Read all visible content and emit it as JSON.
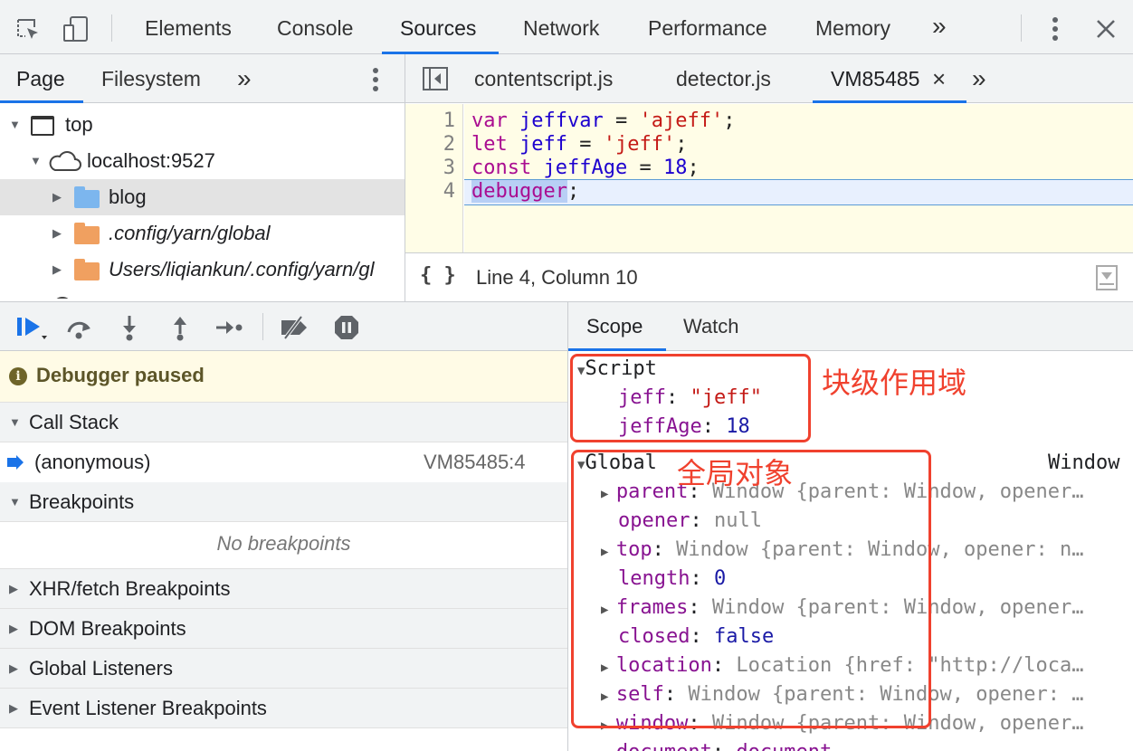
{
  "topbar": {
    "tabs": [
      "Elements",
      "Console",
      "Sources",
      "Network",
      "Performance",
      "Memory"
    ],
    "more": "»"
  },
  "navigator": {
    "tabs": [
      "Page",
      "Filesystem"
    ],
    "more": "»",
    "tree": [
      {
        "label": "top"
      },
      {
        "label": "localhost:9527"
      },
      {
        "label": "blog"
      },
      {
        "label": ".config/yarn/global"
      },
      {
        "label": "Users/liqiankun/.config/yarn/gl"
      }
    ]
  },
  "editor": {
    "tabs": [
      "contentscript.js",
      "detector.js",
      "VM85485"
    ],
    "more": "»",
    "close": "×",
    "line_numbers": [
      "1",
      "2",
      "3",
      "4"
    ],
    "code": [
      {
        "kw": "var",
        "name": " jeffvar",
        "op": " = ",
        "val": "'ajeff'",
        "end": ";"
      },
      {
        "kw": "let",
        "name": " jeff",
        "op": " = ",
        "val": "'jeff'",
        "end": ";"
      },
      {
        "kw": "const",
        "name": " jeffAge",
        "op": " = ",
        "val": "18",
        "end": ";"
      },
      {
        "kw": "debugger",
        "name": "",
        "op": "",
        "val": "",
        "end": ";"
      }
    ],
    "format_label": "{ }",
    "status": "Line 4, Column 10"
  },
  "debugger": {
    "paused": "Debugger paused",
    "sections": {
      "call_stack": "Call Stack",
      "breakpoints": "Breakpoints",
      "xhr": "XHR/fetch Breakpoints",
      "dom": "DOM Breakpoints",
      "global_listeners": "Global Listeners",
      "event_listener": "Event Listener Breakpoints"
    },
    "frame": {
      "name": "(anonymous)",
      "location": "VM85485:4"
    },
    "no_breakpoints": "No breakpoints"
  },
  "scope": {
    "tabs": [
      "Scope",
      "Watch"
    ],
    "script": {
      "title": "Script",
      "items": [
        {
          "key": "jeff",
          "value": "\"jeff\""
        },
        {
          "key": "jeffAge",
          "value": "18"
        }
      ]
    },
    "global": {
      "title": "Global",
      "type": "Window",
      "items": [
        {
          "key": "parent",
          "value": "Window {parent: Window, opener…"
        },
        {
          "key": "opener",
          "value": "null"
        },
        {
          "key": "top",
          "value": "Window {parent: Window, opener: n…"
        },
        {
          "key": "length",
          "value": "0"
        },
        {
          "key": "frames",
          "value": "Window {parent: Window, opener…"
        },
        {
          "key": "closed",
          "value": "false"
        },
        {
          "key": "location",
          "value": "Location {href: \"http://loca…"
        },
        {
          "key": "self",
          "value": "Window {parent: Window, opener: …"
        },
        {
          "key": "window",
          "value": "Window {parent: Window, opener…"
        },
        {
          "key": "document",
          "value": "document"
        }
      ]
    }
  },
  "annotations": {
    "block_scope": "块级作用域",
    "global_object": "全局对象"
  },
  "colors": {
    "accent": "#1a73e8",
    "annotation": "#f0412e",
    "folder_blue": "#7cb6ee",
    "folder_orange": "#f0a060"
  }
}
